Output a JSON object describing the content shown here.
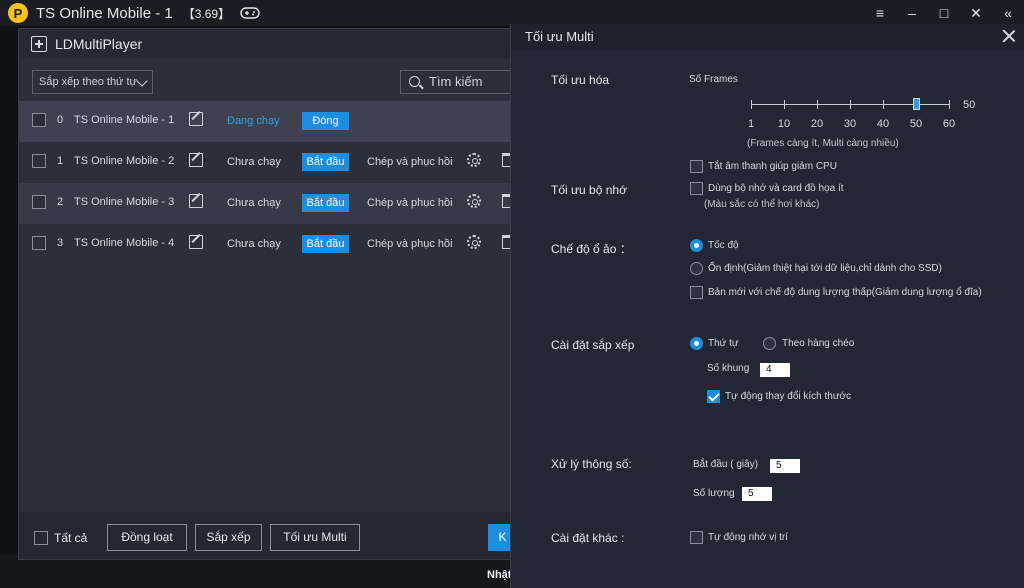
{
  "topbar": {
    "title": "TS Online Mobile - 1",
    "version": "【3.69】",
    "controls": [
      "≡",
      "–",
      "□",
      "✕",
      "«"
    ]
  },
  "ld": {
    "title": "LDMultiPlayer",
    "sort_label": "Sắp xếp theo thứ tự",
    "search_placeholder": "Tìm kiếm",
    "rows": [
      {
        "index": "0",
        "name": "TS Online Mobile - 1",
        "status": "Đang chạy",
        "action": "Đóng",
        "copy": ""
      },
      {
        "index": "1",
        "name": "TS Online Mobile - 2",
        "status": "Chưa chạy",
        "action": "Bắt đầu",
        "copy": "Chép và phục hồi"
      },
      {
        "index": "2",
        "name": "TS Online Mobile - 3",
        "status": "Chưa chạy",
        "action": "Bắt đầu",
        "copy": "Chép và phục hồi"
      },
      {
        "index": "3",
        "name": "TS Online Mobile - 4",
        "status": "Chưa chạy",
        "action": "Bắt đầu",
        "copy": "Chép và phục hồi"
      }
    ],
    "footer": {
      "select_all": "Tất cả",
      "batch": "Đồng loạt",
      "sort": "Sắp xếp",
      "optimize": "Tối ưu Multi",
      "partial_button": "K"
    }
  },
  "backdrop_text": "Nhật",
  "dialog": {
    "title": "Tối ưu Multi",
    "optimize": {
      "section": "Tối ưu hóa",
      "frames_label": "Số Frames",
      "frames_value": 50,
      "frames_value_text": "50",
      "ticks": [
        "1",
        "10",
        "20",
        "30",
        "40",
        "50",
        "60"
      ],
      "frames_note": "(Frames càng ít, Multi càng nhiều)",
      "mute_label": "Tắt âm thanh giúp giảm CPU",
      "mute_checked": false
    },
    "memory": {
      "section": "Tối ưu bộ nhớ",
      "low_mem_label": "Dùng bộ nhớ và card đồ họa ít",
      "low_mem_note": "(Màu sắc có thể hơi khác)",
      "low_mem_checked": false
    },
    "disk": {
      "section": "Chế độ ổ ảo ：",
      "speed_label": "Tốc độ",
      "stable_label": "Ổn định(Giảm thiệt hại tới dữ liệu,chỉ dành cho SSD)",
      "new_label": "Bản mới với chế độ dung lượng thấp(Giảm dung lượng ổ đĩa)",
      "selected": "speed"
    },
    "arrange": {
      "section": "Cài đặt sắp xếp",
      "order_label": "Thứ tự",
      "diagonal_label": "Theo hàng chéo",
      "frames_count_label": "Số khung",
      "frames_count": "4",
      "auto_resize_label": "Tự động thay đổi kích thước",
      "auto_resize_checked": true
    },
    "params": {
      "section": "Xử lý thông số:",
      "start_label": "Bắt đầu ( giây)",
      "start_value": "5",
      "count_label": "Số lượng",
      "count_value": "5"
    },
    "other": {
      "section": "Cài đặt khác :",
      "remember_label": "Tự động nhớ vị trí",
      "remember_checked": false
    }
  },
  "colors": {
    "accent": "#1a8ee0",
    "running": "#2e9fe0",
    "logo": "#f4c21a"
  },
  "icons": [
    "ld-logo-icon",
    "gamepad-icon",
    "plus-icon",
    "search-icon",
    "chevron-down-icon",
    "edit-icon",
    "gear-icon",
    "trash-icon",
    "close-icon"
  ]
}
